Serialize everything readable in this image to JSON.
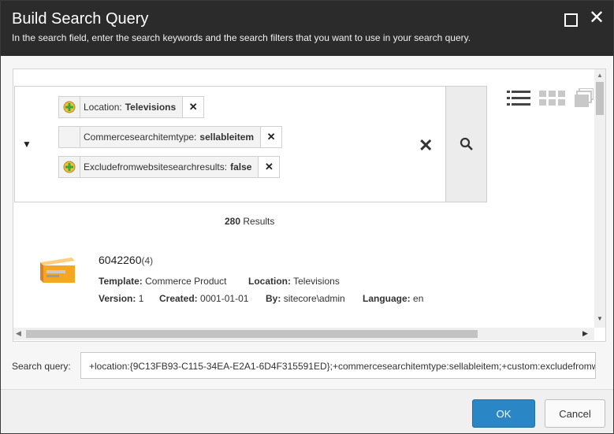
{
  "dialog": {
    "title": "Build Search Query",
    "subtitle": "In the search field, enter the search keywords and the search filters that you want to use in your search query."
  },
  "filters": [
    {
      "label": "Location:",
      "value": "Televisions",
      "icon": "green-plus-icon"
    },
    {
      "label": "Commercesearchitemtype:",
      "value": "sellableitem",
      "icon": ""
    },
    {
      "label": "Excludefromwebsitesearchresults:",
      "value": "false",
      "icon": "green-plus-icon"
    }
  ],
  "results": {
    "count": "280",
    "label": "Results"
  },
  "item": {
    "title": "6042260",
    "version_count": "(4)",
    "template_label": "Template:",
    "template_value": "Commerce Product",
    "location_label": "Location:",
    "location_value": "Televisions",
    "version_label": "Version:",
    "version_value": "1",
    "created_label": "Created:",
    "created_value": "0001-01-01",
    "by_label": "By:",
    "by_value": "sitecore\\admin",
    "language_label": "Language:",
    "language_value": "en"
  },
  "search_query": {
    "label": "Search query:",
    "value": "+location:{9C13FB93-C115-34EA-E2A1-6D4F315591ED};+commercesearchitemtype:sellableitem;+custom:excludefromwebsitesearchresults|false"
  },
  "buttons": {
    "ok": "OK",
    "cancel": "Cancel"
  },
  "colors": {
    "titlebar": "#2b2b2b",
    "ok_button": "#2a86c4"
  }
}
